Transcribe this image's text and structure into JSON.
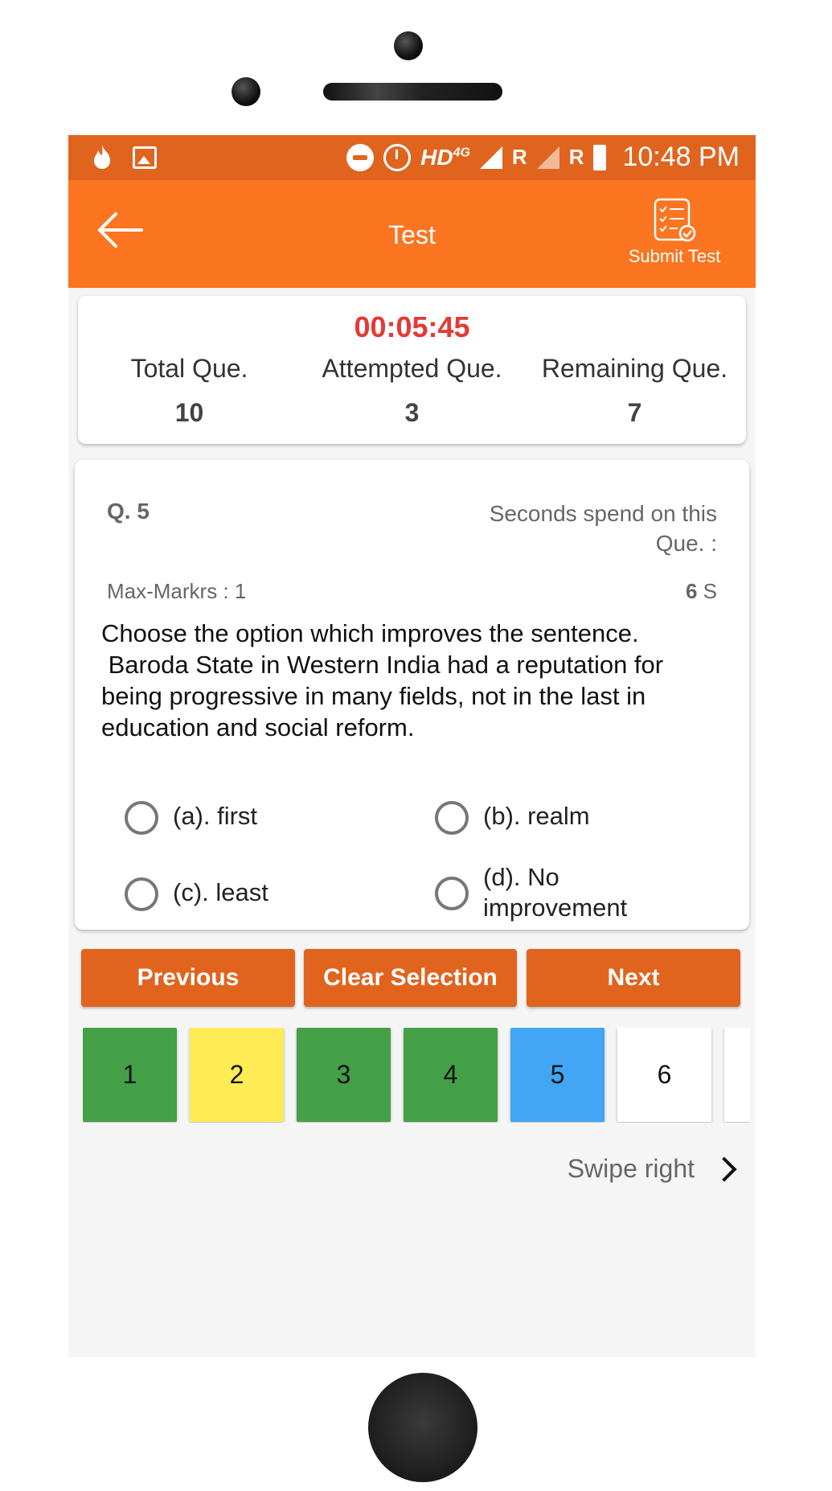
{
  "status_bar": {
    "network_label": "HD",
    "network_sup": "4G",
    "roaming_1": "R",
    "roaming_2": "R",
    "time": "10:48 PM"
  },
  "app_bar": {
    "title": "Test",
    "submit_label": "Submit Test",
    "icons": [
      "back-arrow-icon",
      "submit-checklist-icon"
    ]
  },
  "stats": {
    "timer": "00:05:45",
    "total_label": "Total Que.",
    "total_value": "10",
    "attempted_label": "Attempted Que.",
    "attempted_value": "3",
    "remaining_label": "Remaining Que.",
    "remaining_value": "7"
  },
  "question": {
    "number": "Q. 5",
    "seconds_label": "Seconds spend on this Que. :",
    "max_marks": "Max-Markrs : 1",
    "seconds_value": "6",
    "seconds_unit": "S",
    "text": "Choose the option which improves the sentence.\n Baroda State in Western India had a reputation for being progressive in many fields, not in the last in education and social reform.",
    "options": [
      {
        "label": "(a).  first"
      },
      {
        "label": "(b).  realm"
      },
      {
        "label": "(c).  least"
      },
      {
        "label": "(d).  No improvement"
      }
    ]
  },
  "buttons": {
    "previous": "Previous",
    "clear": "Clear Selection",
    "next": "Next"
  },
  "question_nav": [
    {
      "label": "1",
      "color": "#43a047"
    },
    {
      "label": "2",
      "color": "#ffeb55"
    },
    {
      "label": "3",
      "color": "#43a047"
    },
    {
      "label": "4",
      "color": "#43a047"
    },
    {
      "label": "5",
      "color": "#42a5f5"
    },
    {
      "label": "6",
      "color": "#ffffff"
    },
    {
      "label": "",
      "color": "#ffffff"
    }
  ],
  "swipe_hint": "Swipe right",
  "colors": {
    "status_bar": "#e0641e",
    "app_bar": "#fc7520",
    "timer": "#e53935",
    "button": "#e0641e"
  }
}
